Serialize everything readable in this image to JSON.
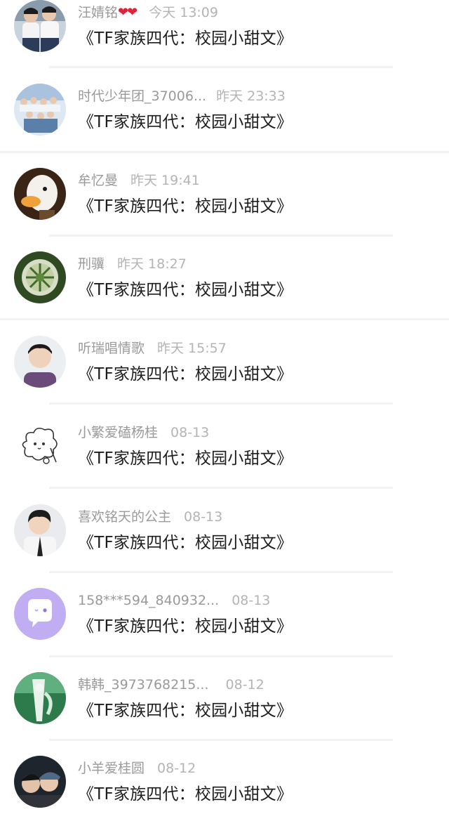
{
  "comments": [
    {
      "name": "汪婧铭",
      "hearts": "❤❤",
      "time": "今天 13:09",
      "title": "《TF家族四代：校园小甜文》",
      "avatar": "two-boys-photo",
      "accent": "#3a4a62"
    },
    {
      "name": "时代少年团_37006...",
      "time": "昨天 23:33",
      "title": "《TF家族四代：校园小甜文》",
      "avatar": "group-photo",
      "accent": "#7aa0c8"
    },
    {
      "name": "牟忆曼",
      "time": "昨天 19:41",
      "title": "《TF家族四代：校园小甜文》",
      "avatar": "duck-photo",
      "accent": "#5a3a22"
    },
    {
      "name": "刑骥",
      "time": "昨天 18:27",
      "title": "《TF家族四代：校园小甜文》",
      "avatar": "plant-photo",
      "accent": "#3f6b2f"
    },
    {
      "name": "听瑞唱情歌",
      "time": "昨天 15:57",
      "title": "《TF家族四代：校园小甜文》",
      "avatar": "boy-portrait",
      "accent": "#6b4b7a"
    },
    {
      "name": "小繁爱磕杨桂",
      "time": "08-13",
      "title": "《TF家族四代：校园小甜文》",
      "avatar": "doodle-sheep",
      "accent": "#333333"
    },
    {
      "name": "喜欢铭天的公主",
      "time": "08-13",
      "title": "《TF家族四代：校园小甜文》",
      "avatar": "boy-portrait-2",
      "accent": "#2b2b2b"
    },
    {
      "name": "158***594_840932...",
      "time": "08-13",
      "title": "《TF家族四代：校园小甜文》",
      "avatar": "default-chat-avatar",
      "accent": "#b9a6f0"
    },
    {
      "name": "韩韩_3973768215...",
      "time": "08-12",
      "title": "《TF家族四代：校园小甜文》",
      "avatar": "green-photo",
      "accent": "#2f8a55"
    },
    {
      "name": "小羊爱桂圆",
      "time": "08-12",
      "title": "《TF家族四代：校园小甜文》",
      "avatar": "cap-boys-photo",
      "accent": "#2a3340"
    }
  ]
}
